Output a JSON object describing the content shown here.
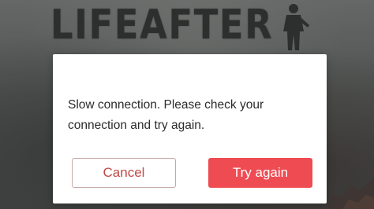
{
  "background": {
    "logo_text": "LIFEAFTER"
  },
  "dialog": {
    "message": "Slow connection. Please check your connection and try again.",
    "cancel_label": "Cancel",
    "retry_label": "Try again"
  },
  "colors": {
    "retry_button_bg": "#ee4b52",
    "cancel_button_text": "#bf4a45",
    "dialog_bg": "#ffffff"
  }
}
